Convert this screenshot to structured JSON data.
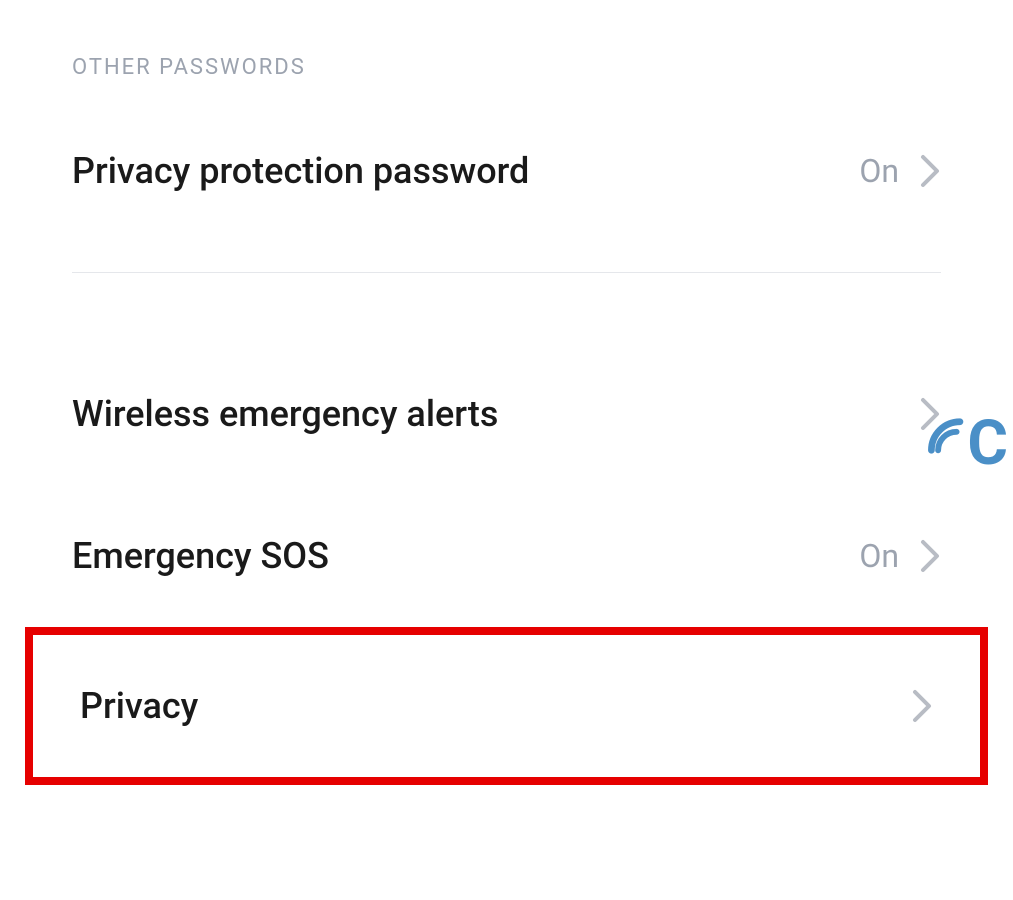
{
  "section_header": "OTHER PASSWORDS",
  "rows": {
    "privacy_protection": {
      "label": "Privacy protection password",
      "value": "On"
    },
    "wireless_emergency": {
      "label": "Wireless emergency alerts"
    },
    "emergency_sos": {
      "label": "Emergency SOS",
      "value": "On"
    },
    "privacy": {
      "label": "Privacy"
    }
  }
}
